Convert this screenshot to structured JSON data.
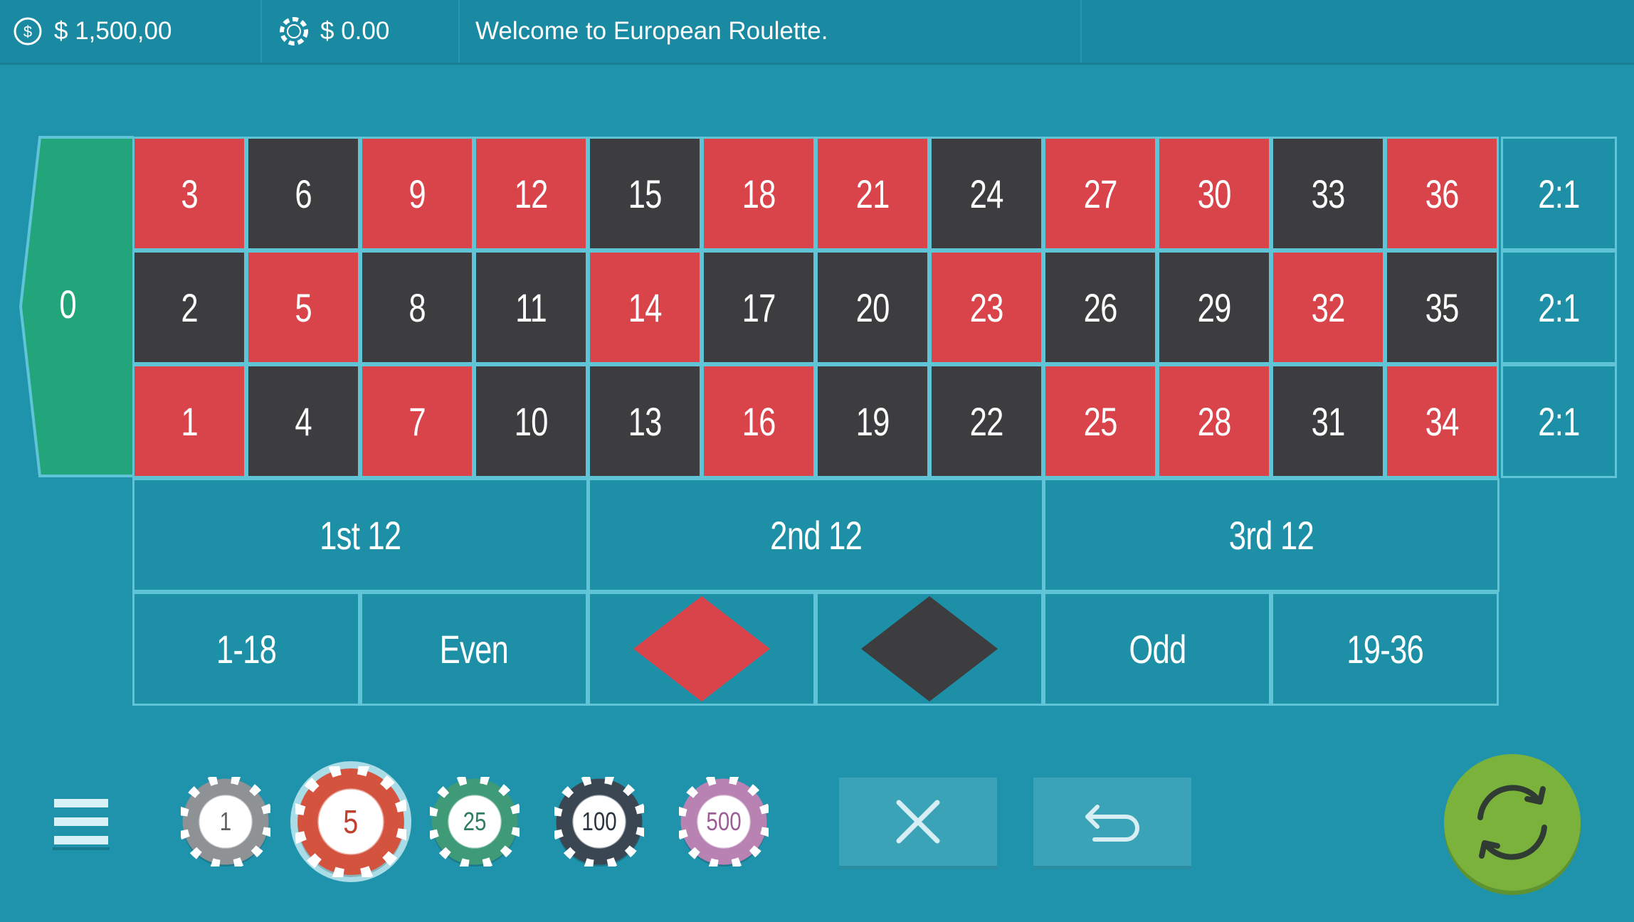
{
  "header": {
    "balance": "$ 1,500,00",
    "bet": "$ 0.00",
    "message": "Welcome to European Roulette."
  },
  "table": {
    "zero": "0",
    "rows": [
      [
        {
          "n": "3",
          "c": "red"
        },
        {
          "n": "6",
          "c": "black"
        },
        {
          "n": "9",
          "c": "red"
        },
        {
          "n": "12",
          "c": "red"
        },
        {
          "n": "15",
          "c": "black"
        },
        {
          "n": "18",
          "c": "red"
        },
        {
          "n": "21",
          "c": "red"
        },
        {
          "n": "24",
          "c": "black"
        },
        {
          "n": "27",
          "c": "red"
        },
        {
          "n": "30",
          "c": "red"
        },
        {
          "n": "33",
          "c": "black"
        },
        {
          "n": "36",
          "c": "red"
        }
      ],
      [
        {
          "n": "2",
          "c": "black"
        },
        {
          "n": "5",
          "c": "red"
        },
        {
          "n": "8",
          "c": "black"
        },
        {
          "n": "11",
          "c": "black"
        },
        {
          "n": "14",
          "c": "red"
        },
        {
          "n": "17",
          "c": "black"
        },
        {
          "n": "20",
          "c": "black"
        },
        {
          "n": "23",
          "c": "red"
        },
        {
          "n": "26",
          "c": "black"
        },
        {
          "n": "29",
          "c": "black"
        },
        {
          "n": "32",
          "c": "red"
        },
        {
          "n": "35",
          "c": "black"
        }
      ],
      [
        {
          "n": "1",
          "c": "red"
        },
        {
          "n": "4",
          "c": "black"
        },
        {
          "n": "7",
          "c": "red"
        },
        {
          "n": "10",
          "c": "black"
        },
        {
          "n": "13",
          "c": "black"
        },
        {
          "n": "16",
          "c": "red"
        },
        {
          "n": "19",
          "c": "black"
        },
        {
          "n": "22",
          "c": "black"
        },
        {
          "n": "25",
          "c": "red"
        },
        {
          "n": "28",
          "c": "red"
        },
        {
          "n": "31",
          "c": "black"
        },
        {
          "n": "34",
          "c": "red"
        }
      ]
    ],
    "column_bets": [
      "2:1",
      "2:1",
      "2:1"
    ],
    "dozens": [
      "1st 12",
      "2nd 12",
      "3rd 12"
    ],
    "outside": {
      "low": "1-18",
      "even": "Even",
      "red_color": "#d9434a",
      "black_color": "#3d3c3e",
      "odd": "Odd",
      "high": "19-36"
    }
  },
  "chips": [
    {
      "label": "1",
      "color": "#8f9294",
      "text_color": "#5c5f62",
      "selected": false
    },
    {
      "label": "5",
      "color": "#d4533f",
      "text_color": "#c2412e",
      "selected": true
    },
    {
      "label": "25",
      "color": "#3f9a78",
      "text_color": "#2f7d5f",
      "selected": false
    },
    {
      "label": "100",
      "color": "#3a4652",
      "text_color": "#2b3540",
      "selected": false
    },
    {
      "label": "500",
      "color": "#b882b2",
      "text_color": "#9d5d97",
      "selected": false
    }
  ],
  "controls": {
    "menu_icon": "hamburger-icon",
    "clear_icon": "close-icon",
    "undo_icon": "undo-icon",
    "spin_icon": "refresh-icon",
    "spin_color": "#7ab23c"
  }
}
